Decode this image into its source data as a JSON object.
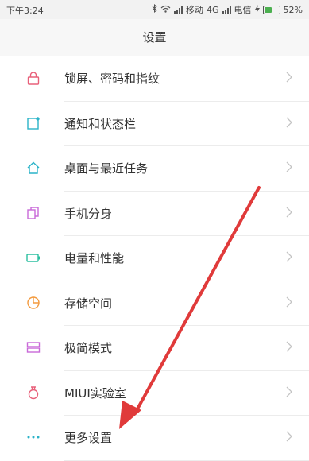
{
  "status_bar": {
    "time": "下午3:24",
    "carrier1": "移动",
    "network1": "4G",
    "carrier2": "电信",
    "battery": "52%",
    "battery_level": 0.52
  },
  "header": {
    "title": "设置"
  },
  "items": [
    {
      "label": "锁屏、密码和指纹",
      "icon": "lock-icon",
      "color": "#e8607a"
    },
    {
      "label": "通知和状态栏",
      "icon": "notification-icon",
      "color": "#2ab3c8"
    },
    {
      "label": "桌面与最近任务",
      "icon": "home-icon",
      "color": "#2ab3c8"
    },
    {
      "label": "手机分身",
      "icon": "dual-phone-icon",
      "color": "#c96ad8"
    },
    {
      "label": "电量和性能",
      "icon": "battery-icon",
      "color": "#2bbfa0"
    },
    {
      "label": "存储空间",
      "icon": "storage-pie-icon",
      "color": "#f39a3e"
    },
    {
      "label": "极简模式",
      "icon": "simple-mode-icon",
      "color": "#c96ad8"
    },
    {
      "label": "MIUI实验室",
      "icon": "lab-flask-icon",
      "color": "#e8607a"
    },
    {
      "label": "更多设置",
      "icon": "more-dots-icon",
      "color": "#2ab3c8"
    }
  ],
  "annotation": {
    "color": "#e03a3a"
  }
}
